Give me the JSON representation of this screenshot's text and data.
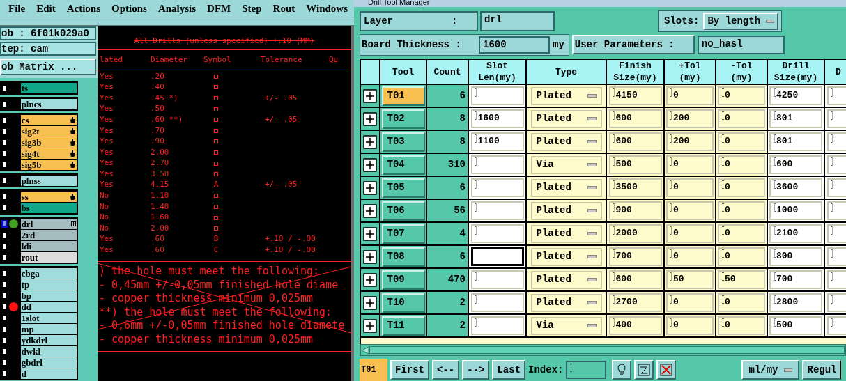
{
  "menu": [
    "File",
    "Edit",
    "Actions",
    "Options",
    "Analysis",
    "DFM",
    "Step",
    "Rout",
    "Windows"
  ],
  "job": {
    "job_line": "ob : 6f01k029a0",
    "step_line": "tep: cam",
    "matrix_button": "ob Matrix ..."
  },
  "layer_groups": [
    [
      {
        "name": "ts",
        "color": "#10a888",
        "hand": false,
        "expand": false,
        "current": false
      }
    ],
    [
      {
        "name": "plncs",
        "color": "#a0dcdc",
        "hand": false,
        "expand": false,
        "current": false
      }
    ],
    [
      {
        "name": "cs",
        "color": "#f8c050",
        "hand": true,
        "expand": false,
        "current": false
      },
      {
        "name": "sig2t",
        "color": "#f8c050",
        "hand": true,
        "expand": false,
        "current": false
      },
      {
        "name": "sig3b",
        "color": "#f8c050",
        "hand": true,
        "expand": false,
        "current": false
      },
      {
        "name": "sig4t",
        "color": "#f8c050",
        "hand": true,
        "expand": false,
        "current": false
      },
      {
        "name": "sig5b",
        "color": "#f8c050",
        "hand": true,
        "expand": false,
        "current": false
      }
    ],
    [
      {
        "name": "plnss",
        "color": "#a0dcdc",
        "hand": false,
        "expand": false,
        "current": false
      }
    ],
    [
      {
        "name": "ss",
        "color": "#f8c050",
        "hand": true,
        "expand": false,
        "current": false
      },
      {
        "name": "bs",
        "color": "#10a888",
        "hand": false,
        "expand": false,
        "current": false
      }
    ],
    [
      {
        "name": "drl",
        "color": "#a4bcc0",
        "hand": false,
        "dot": {
          "color": "#40a020"
        },
        "expand": true,
        "current": true
      },
      {
        "name": "2rd",
        "color": "#a4bcc0",
        "hand": false,
        "expand": false,
        "current": false
      },
      {
        "name": "ldi",
        "color": "#a4bcc0",
        "hand": false,
        "expand": false,
        "current": false
      },
      {
        "name": "rout",
        "color": "#dcdcdc",
        "hand": false,
        "expand": false,
        "current": false
      }
    ],
    [
      {
        "name": "cbga",
        "color": "#a0dcdc",
        "hand": false,
        "expand": false,
        "current": false
      },
      {
        "name": "tp",
        "color": "#a0dcdc",
        "hand": false,
        "expand": false,
        "current": false
      },
      {
        "name": "bp",
        "color": "#a0dcdc",
        "hand": false,
        "expand": false,
        "current": false
      },
      {
        "name": "dd",
        "color": "#a0dcdc",
        "hand": false,
        "dot": {
          "color": "#ff1010"
        },
        "expand": false,
        "current": false
      },
      {
        "name": "1slot",
        "color": "#a0dcdc",
        "hand": false,
        "expand": false,
        "current": false
      },
      {
        "name": "mp",
        "color": "#a0dcdc",
        "hand": false,
        "expand": false,
        "current": false
      },
      {
        "name": "ydkdrl",
        "color": "#a0dcdc",
        "hand": false,
        "expand": false,
        "current": false
      },
      {
        "name": "dwkl",
        "color": "#a0dcdc",
        "hand": false,
        "expand": false,
        "current": false
      },
      {
        "name": "gbdrl",
        "color": "#a0dcdc",
        "hand": false,
        "expand": false,
        "current": false
      },
      {
        "name": "d",
        "color": "#a0dcdc",
        "hand": false,
        "expand": false,
        "current": false
      }
    ]
  ],
  "drawing": {
    "heading": "All Drills (unless specified) +.10 (MM)",
    "columns": [
      "lated",
      "Diameter",
      "Symbol",
      "Tolerance",
      "Qu"
    ],
    "rows": [
      {
        "plated": "Yes",
        "diameter": ".20"
      },
      {
        "plated": "Yes",
        "diameter": ".40"
      },
      {
        "plated": "Yes",
        "diameter": ".45 *)",
        "tolerance": "+/- .05"
      },
      {
        "plated": "Yes",
        "diameter": ".50"
      },
      {
        "plated": "Yes",
        "diameter": ".60 **)",
        "tolerance": "+/- .05"
      },
      {
        "plated": "Yes",
        "diameter": ".70"
      },
      {
        "plated": "Yes",
        "diameter": ".90"
      },
      {
        "plated": "Yes",
        "diameter": "2.00"
      },
      {
        "plated": "Yes",
        "diameter": "2.70"
      },
      {
        "plated": "Yes",
        "diameter": "3.50"
      },
      {
        "plated": "Yes",
        "diameter": "4.15",
        "symbol": "A",
        "tolerance": "+/- .05"
      },
      {
        "plated": "No",
        "diameter": "1.10"
      },
      {
        "plated": "No",
        "diameter": "1.40"
      },
      {
        "plated": "No",
        "diameter": "1.60"
      },
      {
        "plated": "No",
        "diameter": "2.00"
      },
      {
        "plated": "Yes",
        "diameter": ".60",
        "symbol": "B",
        "tolerance": "+.10 / -.00"
      },
      {
        "plated": "Yes",
        "diameter": ".60",
        "symbol": "C",
        "tolerance": "+.10 / -.00"
      }
    ],
    "notes": [
      ") the hole must meet the following:",
      "- 0,45mm +/-0,05mm finished hole diame",
      "- copper thickness minimum 0,025mm",
      "**) the hole must meet the following:",
      "- 0,6mm +/-0,05mm finished hole diamete",
      "- copper thickness minimum 0,025mm"
    ]
  },
  "dialog": {
    "title": "Drill Tool Manager",
    "layer_label": "Layer          :",
    "layer_value": "drl",
    "slots_label": "Slots:",
    "slots_value": "By length",
    "thickness_label": "Board Thickness :",
    "thickness_value": "1600",
    "thickness_unit": "my",
    "user_params_button": "User Parameters :",
    "user_params_value": "no_hasl",
    "columns": [
      "Tool",
      "Count",
      "Slot\nLen(my)",
      "Type",
      "Finish\nSize(my)",
      "+Tol\n(my)",
      "-Tol\n(my)",
      "Drill\nSize(my)",
      "D"
    ],
    "rows": [
      {
        "tool": "T01",
        "count": "6",
        "type": "Plated",
        "finish": "4150",
        "plus": "0",
        "minus": "0",
        "drill": "4250",
        "selected": true,
        "focused": false
      },
      {
        "tool": "T02",
        "count": "8",
        "slot": "1600",
        "type": "Plated",
        "finish": "600",
        "plus": "200",
        "minus": "0",
        "drill": "801",
        "selected": false,
        "focused": false
      },
      {
        "tool": "T03",
        "count": "8",
        "slot": "1100",
        "type": "Plated",
        "finish": "600",
        "plus": "200",
        "minus": "0",
        "drill": "801",
        "selected": false,
        "focused": false
      },
      {
        "tool": "T04",
        "count": "310",
        "type": "Via",
        "finish": "500",
        "plus": "0",
        "minus": "0",
        "drill": "600",
        "selected": false,
        "focused": false
      },
      {
        "tool": "T05",
        "count": "6",
        "type": "Plated",
        "finish": "3500",
        "plus": "0",
        "minus": "0",
        "drill": "3600",
        "selected": false,
        "focused": false
      },
      {
        "tool": "T06",
        "count": "56",
        "type": "Plated",
        "finish": "900",
        "plus": "0",
        "minus": "0",
        "drill": "1000",
        "selected": false,
        "focused": false
      },
      {
        "tool": "T07",
        "count": "4",
        "type": "Plated",
        "finish": "2000",
        "plus": "0",
        "minus": "0",
        "drill": "2100",
        "selected": false,
        "focused": false
      },
      {
        "tool": "T08",
        "count": "6",
        "type": "Plated",
        "finish": "700",
        "plus": "0",
        "minus": "0",
        "drill": "800",
        "selected": false,
        "focused": true
      },
      {
        "tool": "T09",
        "count": "470",
        "type": "Plated",
        "finish": "600",
        "plus": "50",
        "minus": "50",
        "drill": "700",
        "selected": false,
        "focused": false
      },
      {
        "tool": "T10",
        "count": "2",
        "type": "Plated",
        "finish": "2700",
        "plus": "0",
        "minus": "0",
        "drill": "2800",
        "selected": false,
        "focused": false
      },
      {
        "tool": "T11",
        "count": "2",
        "type": "Via",
        "finish": "400",
        "plus": "0",
        "minus": "0",
        "drill": "500",
        "selected": false,
        "focused": false
      }
    ],
    "current_tool": "T01",
    "nav_buttons": [
      "First",
      "<--",
      "-->",
      "Last"
    ],
    "index_label": "Index:",
    "units_value": "ml/my",
    "last_button": "Regul"
  }
}
